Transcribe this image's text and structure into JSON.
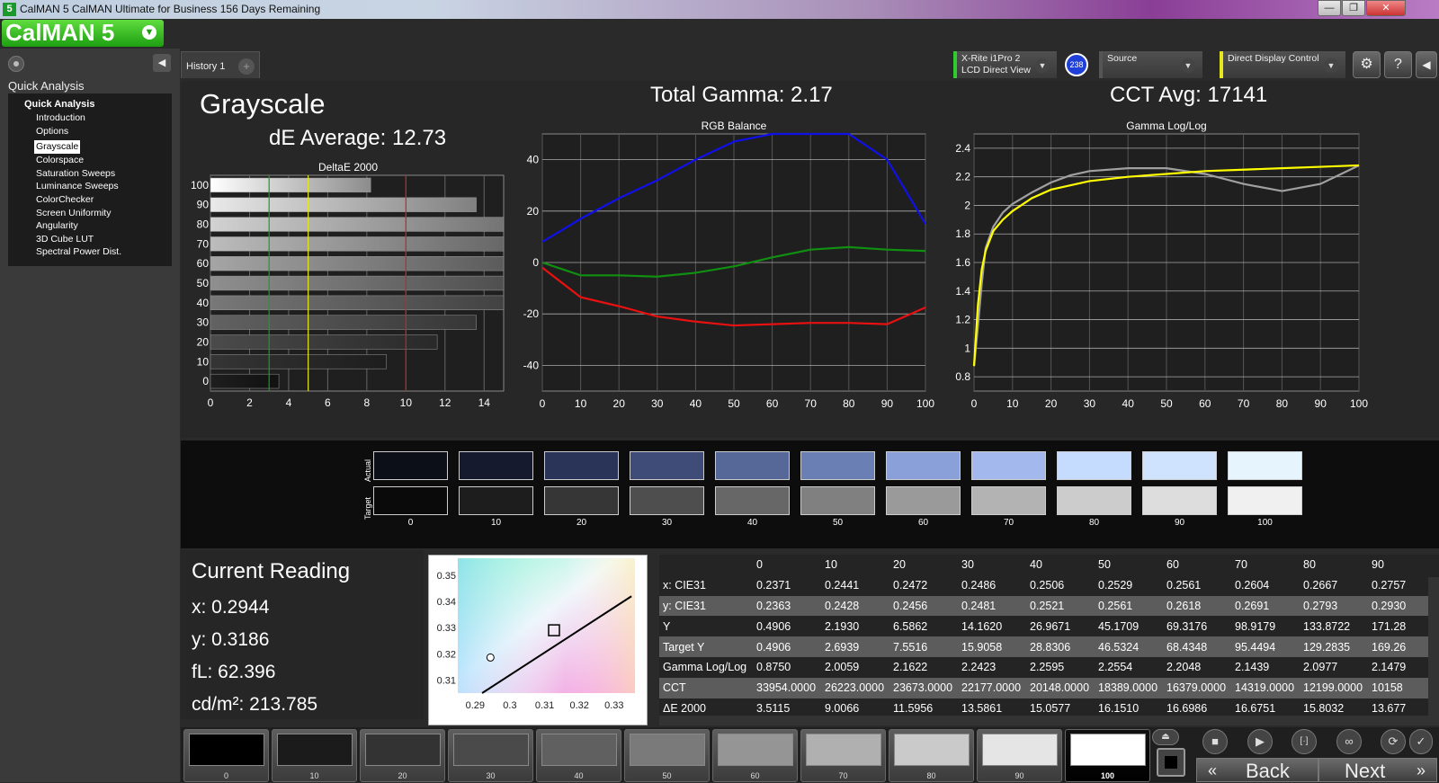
{
  "window": {
    "title": "CalMAN 5 CalMAN Ultimate for Business 156 Days Remaining",
    "minimize": "—",
    "restore": "❐",
    "close": "✕"
  },
  "logo": {
    "text": "CalMAN 5",
    "dropdown_icon": "chevron-down-icon"
  },
  "sidebar": {
    "title": "Quick Analysis",
    "tree_root": "Quick Analysis",
    "items": [
      {
        "label": "Introduction",
        "selected": false
      },
      {
        "label": "Options",
        "selected": false
      },
      {
        "label": "Grayscale",
        "selected": true
      },
      {
        "label": "Colorspace",
        "selected": false
      },
      {
        "label": "Saturation Sweeps",
        "selected": false
      },
      {
        "label": "Luminance Sweeps",
        "selected": false
      },
      {
        "label": "ColorChecker",
        "selected": false
      },
      {
        "label": "Screen Uniformity",
        "selected": false
      },
      {
        "label": "Angularity",
        "selected": false
      },
      {
        "label": "3D Cube LUT",
        "selected": false
      },
      {
        "label": "Spectral Power Dist.",
        "selected": false
      }
    ]
  },
  "tabs": {
    "history": "History 1",
    "add": "+"
  },
  "devices": {
    "meter_line1": "X-Rite i1Pro 2",
    "meter_line2": "LCD Direct View",
    "meter_badge": "238",
    "source": "Source",
    "display": "Direct Display Control",
    "meter_color": "#2ecc2e",
    "display_color": "#e6e61e"
  },
  "toolbar": {
    "settings": "⚙",
    "help": "?",
    "collapse": "◀"
  },
  "headings": {
    "grayscale": "Grayscale",
    "de_average": "dE Average: 12.73",
    "total_gamma": "Total Gamma: 2.17",
    "cct_avg": "CCT Avg: 17141"
  },
  "chart_data": [
    {
      "type": "bar",
      "title": "DeltaE 2000",
      "orientation": "horizontal",
      "categories": [
        "100",
        "90",
        "80",
        "70",
        "60",
        "50",
        "40",
        "30",
        "20",
        "10",
        "0"
      ],
      "values": [
        8.2,
        13.6,
        15.1,
        15.1,
        15.1,
        15.1,
        15.1,
        13.6,
        11.6,
        9.0,
        3.5
      ],
      "xticks": [
        "0",
        "2",
        "4",
        "6",
        "8",
        "10",
        "12",
        "14"
      ],
      "xlim": [
        0,
        15
      ],
      "threshold_lines": [
        {
          "value": 3,
          "color": "#1e9e1e"
        },
        {
          "value": 5,
          "color": "#e6e61e"
        },
        {
          "value": 10,
          "color": "#d42020"
        }
      ]
    },
    {
      "type": "line",
      "title": "RGB Balance",
      "x": [
        0,
        10,
        20,
        30,
        40,
        50,
        60,
        70,
        80,
        90,
        100
      ],
      "xticks": [
        "0",
        "10",
        "20",
        "30",
        "40",
        "50",
        "60",
        "70",
        "80",
        "90",
        "100"
      ],
      "yticks": [
        "40",
        "20",
        "0",
        "-20",
        "-40"
      ],
      "ylim": [
        -50,
        50
      ],
      "series": [
        {
          "color": "#1010e8",
          "values": [
            8,
            17,
            25,
            32,
            40,
            47,
            50,
            50,
            50,
            40,
            15
          ]
        },
        {
          "color": "#109010",
          "values": [
            0,
            -5,
            -5,
            -5.5,
            -4,
            -1.5,
            2,
            5,
            6,
            5,
            4.5
          ]
        },
        {
          "color": "#e81010",
          "values": [
            -2,
            -13.5,
            -17,
            -21,
            -23,
            -24.5,
            -24,
            -23.5,
            -23.5,
            -24,
            -17.5
          ]
        }
      ]
    },
    {
      "type": "line",
      "title": "Gamma Log/Log",
      "x": [
        0,
        1,
        2,
        3,
        5,
        7.5,
        10,
        15,
        20,
        25,
        30,
        40,
        50,
        60,
        70,
        80,
        90,
        100
      ],
      "xticks": [
        "0",
        "10",
        "20",
        "30",
        "40",
        "50",
        "60",
        "70",
        "80",
        "90",
        "100"
      ],
      "yticks": [
        "2.4",
        "2.2",
        "2",
        "1.8",
        "1.6",
        "1.4",
        "1.2",
        "1",
        "0.8"
      ],
      "ylim": [
        0.7,
        2.5
      ],
      "series": [
        {
          "color": "#a0a0a0",
          "values": [
            0.875,
            1.15,
            1.45,
            1.7,
            1.85,
            1.95,
            2.01,
            2.09,
            2.16,
            2.21,
            2.24,
            2.26,
            2.26,
            2.22,
            2.15,
            2.1,
            2.15,
            2.28
          ]
        },
        {
          "color": "#ffff00",
          "values": [
            0.875,
            1.3,
            1.55,
            1.68,
            1.82,
            1.9,
            1.96,
            2.05,
            2.11,
            2.14,
            2.17,
            2.2,
            2.22,
            2.24,
            2.25,
            2.26,
            2.27,
            2.28
          ]
        }
      ]
    },
    {
      "type": "scatter",
      "title": "",
      "xticks": [
        "0.29",
        "0.3",
        "0.31",
        "0.32",
        "0.33"
      ],
      "yticks": [
        "0.35",
        "0.34",
        "0.33",
        "0.32",
        "0.31"
      ],
      "xlim": [
        0.285,
        0.336
      ],
      "ylim": [
        0.305,
        0.3565
      ],
      "target_point": {
        "x": 0.3127,
        "y": 0.329
      },
      "current_point": {
        "x": 0.2944,
        "y": 0.3186
      },
      "planckian": [
        [
          0.292,
          0.305
        ],
        [
          0.335,
          0.342
        ]
      ]
    }
  ],
  "swatches": {
    "actual_label": "Actual",
    "target_label": "Target",
    "labels": [
      "0",
      "10",
      "20",
      "30",
      "40",
      "50",
      "60",
      "70",
      "80",
      "90",
      "100"
    ],
    "actual": [
      "#0c0e18",
      "#151a2e",
      "#2a3458",
      "#3f4c78",
      "#566898",
      "#6a80b4",
      "#8aa0d8",
      "#a3b8ec",
      "#c6dcfe",
      "#cfe2fe",
      "#e6f4fe"
    ],
    "target": [
      "#0a0a0a",
      "#1d1d1d",
      "#363636",
      "#4e4e4e",
      "#676767",
      "#808080",
      "#9a9a9a",
      "#b3b3b3",
      "#cccccc",
      "#dddddd",
      "#f0f0f0"
    ]
  },
  "current_reading": {
    "title": "Current Reading",
    "x": "x: 0.2944",
    "y": "y: 0.3186",
    "fl": "fL: 62.396",
    "cdm2": "cd/m²: 213.785"
  },
  "table": {
    "columns": [
      "",
      "0",
      "10",
      "20",
      "30",
      "40",
      "50",
      "60",
      "70",
      "80",
      "90"
    ],
    "rows": [
      [
        "x: CIE31",
        "0.2371",
        "0.2441",
        "0.2472",
        "0.2486",
        "0.2506",
        "0.2529",
        "0.2561",
        "0.2604",
        "0.2667",
        "0.2757"
      ],
      [
        "y: CIE31",
        "0.2363",
        "0.2428",
        "0.2456",
        "0.2481",
        "0.2521",
        "0.2561",
        "0.2618",
        "0.2691",
        "0.2793",
        "0.2930"
      ],
      [
        "Y",
        "0.4906",
        "2.1930",
        "6.5862",
        "14.1620",
        "26.9671",
        "45.1709",
        "69.3176",
        "98.9179",
        "133.8722",
        "171.28"
      ],
      [
        "Target Y",
        "0.4906",
        "2.6939",
        "7.5516",
        "15.9058",
        "28.8306",
        "46.5324",
        "68.4348",
        "95.4494",
        "129.2835",
        "169.26"
      ],
      [
        "Gamma Log/Log",
        "0.8750",
        "2.0059",
        "2.1622",
        "2.2423",
        "2.2595",
        "2.2554",
        "2.2048",
        "2.1439",
        "2.0977",
        "2.1479"
      ],
      [
        "CCT",
        "33954.0000",
        "26223.0000",
        "23673.0000",
        "22177.0000",
        "20148.0000",
        "18389.0000",
        "16379.0000",
        "14319.0000",
        "12199.0000",
        "10158"
      ],
      [
        "ΔE 2000",
        "3.5115",
        "9.0066",
        "11.5956",
        "13.5861",
        "15.0577",
        "16.1510",
        "16.6986",
        "16.6751",
        "15.8032",
        "13.677"
      ]
    ]
  },
  "patches": {
    "labels": [
      "0",
      "10",
      "20",
      "30",
      "40",
      "50",
      "60",
      "70",
      "80",
      "90",
      "100"
    ],
    "colors": [
      "#000000",
      "#1b1b1b",
      "#333333",
      "#4a4a4a",
      "#606060",
      "#7a7a7a",
      "#959595",
      "#b0b0b0",
      "#cacaca",
      "#e5e5e5",
      "#ffffff"
    ]
  },
  "controls": {
    "stop": "■",
    "play": "▶",
    "measure": "[·]",
    "loop": "∞",
    "refresh": "⟳",
    "check": "✓",
    "back": "Back",
    "next": "Next",
    "back_arrows": "«",
    "next_arrows": "»"
  }
}
